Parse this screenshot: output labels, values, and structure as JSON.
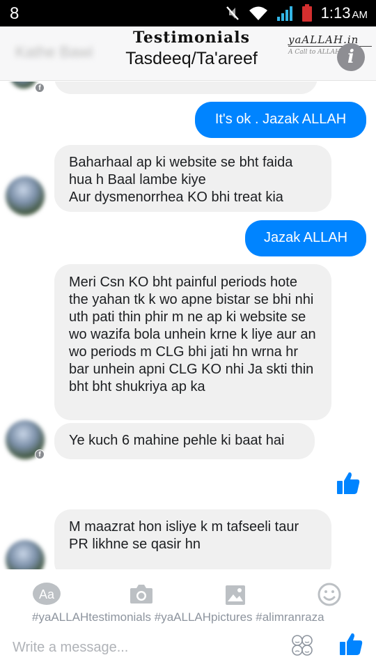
{
  "status_bar": {
    "time": "1:13",
    "ampm": "AM",
    "icons": [
      "notification-8-icon",
      "mute-icon",
      "wifi-icon",
      "signal-icon",
      "battery-icon"
    ]
  },
  "header": {
    "contact_name": "Kathe Bawi",
    "title": "Testimonials",
    "subtitle": "Tasdeeq/Ta'areef",
    "brand_logo": "yaALLAH.in",
    "brand_tagline": "A Call to ALLAH",
    "info_label": "i"
  },
  "messages": {
    "m1": "It's ok . Jazak ALLAH",
    "m2": "Baharhaal ap ki website se bht faida hua h Baal lambe kiye\nAur dysmenorrhea KO bhi treat kia",
    "m3": "Jazak ALLAH",
    "m4": "Meri Csn KO bht painful periods hote the yahan tk k wo  apne bistar se bhi nhi uth pati thin phir m ne ap ki website se wo wazifa bola unhein krne k liye aur an wo periods m CLG bhi jati hn wrna hr bar unhein apni CLG KO nhi Ja skti thin bht bht shukriya ap ka",
    "m5": "Ye kuch 6 mahine pehle ki baat hai",
    "m6": "M maazrat hon isliye k m tafseeli taur PR likhne se qasir hn"
  },
  "composer": {
    "hashtags": "#yaALLAHtestimonials #yaALLAHpictures #alimranraza",
    "placeholder": "Write a message...",
    "toolbar_icons": [
      "text-aa-icon",
      "camera-icon",
      "gallery-icon",
      "emoji-icon"
    ]
  },
  "colors": {
    "accent": "#0084ff",
    "incoming_bubble": "#f0f0f0",
    "toolbar_icon": "#bcc0c4"
  }
}
